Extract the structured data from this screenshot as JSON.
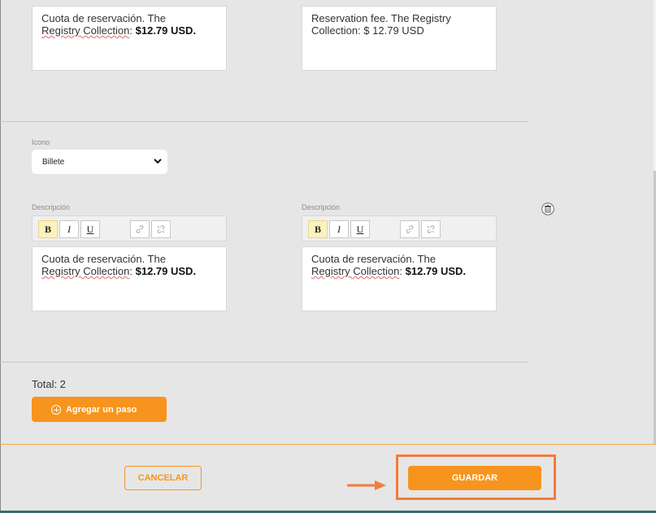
{
  "step1": {
    "desc_es": {
      "line1": "Cuota de reservación. The",
      "link": "Registry Collection",
      "colon": ":",
      "price": "$12.79 USD."
    },
    "desc_en": {
      "line1": "Reservation fee. The Registry",
      "line2": "Collection: $ 12.79 USD"
    }
  },
  "step2": {
    "icon_label": "Icono",
    "icon_value": "Billete",
    "desc_label_es": "Descripción",
    "desc_label_en": "Descripción",
    "toolbar": {
      "bold": "B",
      "italic": "I",
      "underline": "U"
    },
    "desc_es": {
      "line1": "Cuota de reservación. The",
      "link": "Registry Collection",
      "colon": ":",
      "price": "$12.79 USD."
    },
    "desc_en": {
      "line1": "Cuota de reservación. The",
      "link": "Registry Collection",
      "colon": ":",
      "price": "$12.79 USD."
    }
  },
  "total_label": "Total: 2",
  "add_step_label": "Agregar un paso",
  "cancel_label": "CANCELAR",
  "save_label": "GUARDAR",
  "colors": {
    "accent": "#f7941d",
    "highlight": "#f47b3b",
    "background": "#e6e6e6"
  }
}
